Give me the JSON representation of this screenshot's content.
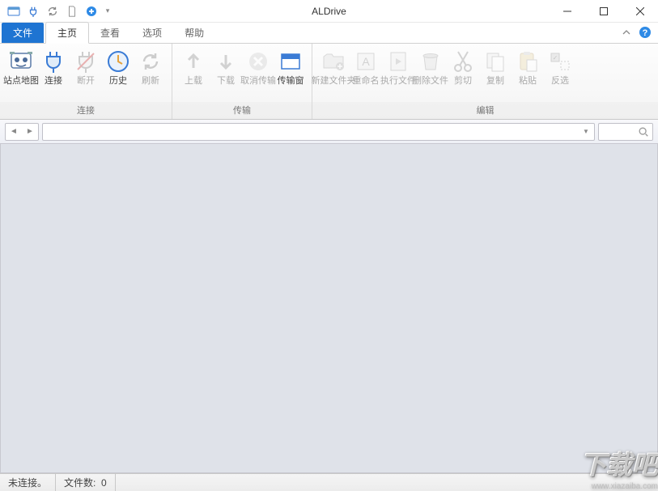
{
  "window": {
    "title": "ALDrive"
  },
  "menu": {
    "file": "文件",
    "home": "主页",
    "view": "查看",
    "options": "选项",
    "help": "帮助"
  },
  "ribbon": {
    "groups": {
      "connect": {
        "label": "连接"
      },
      "transfer": {
        "label": "传输"
      },
      "edit": {
        "label": "编辑"
      }
    },
    "buttons": {
      "sitemap": "站点地图",
      "connect": "连接",
      "disconnect": "断开",
      "history": "历史",
      "refresh": "刷新",
      "upload": "上载",
      "download": "下载",
      "cancel_transfer": "取消传输",
      "transfer_window": "传输窗",
      "new_folder": "新建文件夹",
      "rename": "重命名",
      "execute": "执行文件",
      "delete": "删除文件",
      "cut": "剪切",
      "copy": "复制",
      "paste": "粘贴",
      "invert": "反选"
    }
  },
  "status": {
    "connection": "未连接。",
    "filecount_label": "文件数:",
    "filecount_value": "0"
  },
  "watermark": {
    "text": "下载吧",
    "url": "www.xiazaiba.com"
  }
}
